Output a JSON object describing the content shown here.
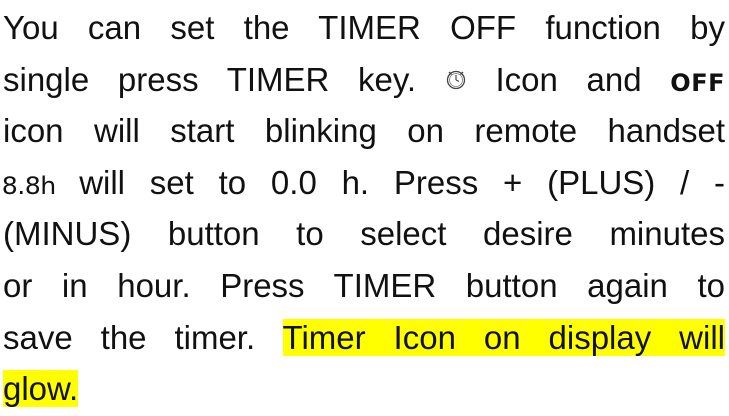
{
  "instructions": {
    "line1": "You can set the TIMER OFF function by",
    "line2_a": "single press TIMER key.",
    "line2_b": "Icon and",
    "off_icon_text": "OFF",
    "line3": "icon will start blinking on remote handset",
    "seg_icon_text": "8.8h",
    "line4_a": "will set to 0.0 h. Press + (PLUS) / -",
    "line5": "(MINUS) button to select desire minutes",
    "line6": "or in hour. Press TIMER button again to",
    "line7_a": "save the timer.",
    "highlight_a": "Timer Icon on display will",
    "highlight_b": "glow.",
    "highlight_color": "#ffff00",
    "icons": [
      "clock-icon",
      "off-icon",
      "segment-display-icon"
    ]
  }
}
